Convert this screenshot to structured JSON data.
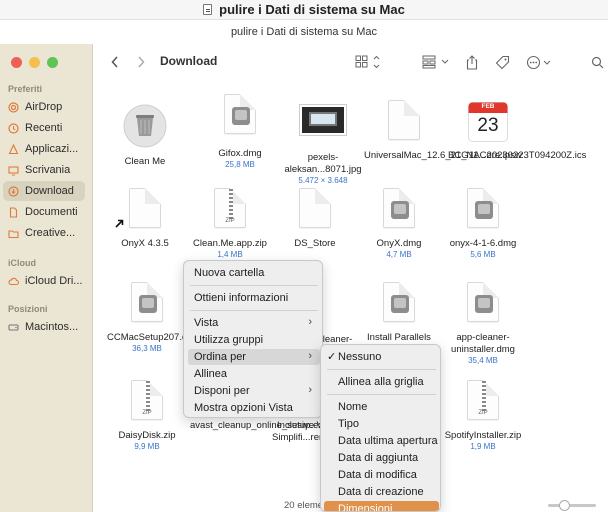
{
  "window": {
    "title": "pulire i Dati di sistema su Mac",
    "subtitle": "pulire i Dati di sistema su Mac"
  },
  "finder": {
    "path_title": "Download",
    "sidebar": {
      "favorites_label": "Preferiti",
      "favorites": [
        {
          "label": "AirDrop",
          "icon": "airdrop-icon"
        },
        {
          "label": "Recenti",
          "icon": "clock-icon"
        },
        {
          "label": "Applicazi...",
          "icon": "apps-icon"
        },
        {
          "label": "Scrivania",
          "icon": "desktop-icon"
        },
        {
          "label": "Download",
          "icon": "download-icon",
          "active": true
        },
        {
          "label": "Documenti",
          "icon": "document-icon"
        },
        {
          "label": "Creative...",
          "icon": "folder-icon"
        }
      ],
      "icloud_label": "iCloud",
      "icloud": [
        {
          "label": "iCloud Dri...",
          "icon": "cloud-icon"
        }
      ],
      "locations_label": "Posizioni",
      "locations": [
        {
          "label": "Macintos...",
          "icon": "disk-icon"
        }
      ]
    },
    "files": [
      {
        "label": "Clean Me",
        "sub": "",
        "icon": "trash-app-icon"
      },
      {
        "label": "Gifox.dmg",
        "sub": "25,8 MB",
        "icon": "dmg-icon"
      },
      {
        "label": "pexels-aleksan...8071.jpg",
        "sub": "5.472 × 3.648",
        "icon": "image-icon"
      },
      {
        "label": "UniversalMac_12.6_21G11...ore.ipsw",
        "sub": "",
        "icon": "document-icon"
      },
      {
        "label": "BC_NAC20230223T094200Z.ics",
        "sub": "",
        "icon": "calendar-icon",
        "cal_month": "FEB",
        "cal_day": "23"
      },
      {
        "label": "OnyX 4.3.5",
        "sub": "",
        "icon": "alias-document-icon"
      },
      {
        "label": "Clean.Me.app.zip",
        "sub": "1,4 MB",
        "icon": "zip-icon"
      },
      {
        "label": "DS_Store",
        "sub": "",
        "icon": "document-icon"
      },
      {
        "label": "OnyX.dmg",
        "sub": "4,7 MB",
        "icon": "dmg-icon"
      },
      {
        "label": "onyx-4-1-6.dmg",
        "sub": "5,6 MB",
        "icon": "dmg-icon"
      },
      {
        "label": "CCMacSetup207.dmg",
        "sub": "36,3 MB",
        "icon": "dmg-icon"
      },
      {
        "label": "cleaner-",
        "sub": "",
        "icon": "dmg-icon"
      },
      {
        "label": "Install Parallels",
        "sub": "",
        "icon": "dmg-icon"
      },
      {
        "label": "app-cleaner-uninstaller.dmg",
        "sub": "35,4 MB",
        "icon": "dmg-icon"
      },
      {
        "label": "DaisyDisk.zip",
        "sub": "9,9 MB",
        "icon": "zip-icon"
      },
      {
        "label": "avast_cleanup_online_setup.exe",
        "sub": "",
        "icon": "document-icon"
      },
      {
        "label": "Inclusive V Simplifi...rer.zip",
        "sub": "",
        "icon": "zip-icon"
      },
      {
        "label": "",
        "sub": "",
        "icon": "zip-icon"
      },
      {
        "label": "SpotifyInstaller.zip",
        "sub": "1,9 MB",
        "icon": "zip-icon"
      }
    ],
    "status": "20 eleme",
    "zip_badge": "ZIP"
  },
  "context_menu": {
    "items": [
      {
        "label": "Nuova cartella",
        "has_sub": false
      },
      {
        "label": "Ottieni informazioni",
        "has_sub": false
      },
      {
        "label": "Vista",
        "has_sub": true
      },
      {
        "label": "Utilizza gruppi",
        "has_sub": false
      },
      {
        "label": "Ordina per",
        "has_sub": true,
        "highlighted": true
      },
      {
        "label": "Allinea",
        "has_sub": false
      },
      {
        "label": "Disponi per",
        "has_sub": true
      },
      {
        "label": "Mostra opzioni Vista",
        "has_sub": false
      }
    ]
  },
  "sort_submenu": {
    "items": [
      {
        "label": "Nessuno",
        "checked": true
      },
      {
        "label": "Allinea alla griglia"
      },
      {
        "label": "Nome"
      },
      {
        "label": "Tipo"
      },
      {
        "label": "Data ultima apertura"
      },
      {
        "label": "Data di aggiunta"
      },
      {
        "label": "Data di modifica"
      },
      {
        "label": "Data di creazione"
      },
      {
        "label": "Dimensioni",
        "highlighted": true
      }
    ]
  },
  "colors": {
    "sidebar_bg": "#ebe6d3",
    "accent": "#e0914a",
    "sub_text": "#3a73c9",
    "traffic_red": "#ee5f57",
    "traffic_yellow": "#f5bf4f",
    "traffic_green": "#5fc454"
  }
}
